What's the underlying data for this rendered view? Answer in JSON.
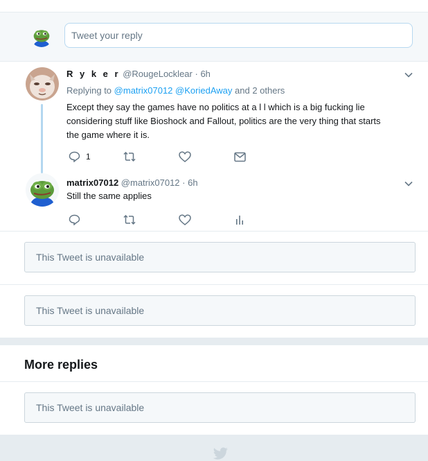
{
  "reply_bar": {
    "placeholder": "Tweet your reply"
  },
  "tweets": [
    {
      "name": "R y k e r",
      "handle": "@RougeLocklear",
      "time": "· 6h",
      "replying_prefix": "Replying to",
      "replying_user_1": "@matrix07012",
      "replying_user_2": "@KoriedAway",
      "replying_suffix": "and 2 others",
      "text_line_1": "Except they say the games have no politics at a l l which is a big fucking lie",
      "text_line_2": "considering stuff like Bioshock and Fallout, politics are the very thing that starts",
      "text_line_3": "the game where it is.",
      "reply_count": "1"
    },
    {
      "name": "matrix07012",
      "handle": "@matrix07012",
      "time": "· 6h",
      "text_line_1": "Still the same applies"
    }
  ],
  "unavailable": [
    "This Tweet is unavailable",
    "This Tweet is unavailable",
    "This Tweet is unavailable"
  ],
  "more_replies": {
    "heading": "More replies"
  },
  "colors": {
    "link": "#1da1f2",
    "thread_line": "#b3d7f0",
    "muted": "#657786",
    "background": "#e6ecf0"
  },
  "icons": [
    "frog-avatar-icon",
    "chevron-down-icon",
    "reply-icon",
    "retweet-icon",
    "like-icon",
    "direct-message-icon",
    "analytics-icon",
    "twitter-bird-icon"
  ]
}
